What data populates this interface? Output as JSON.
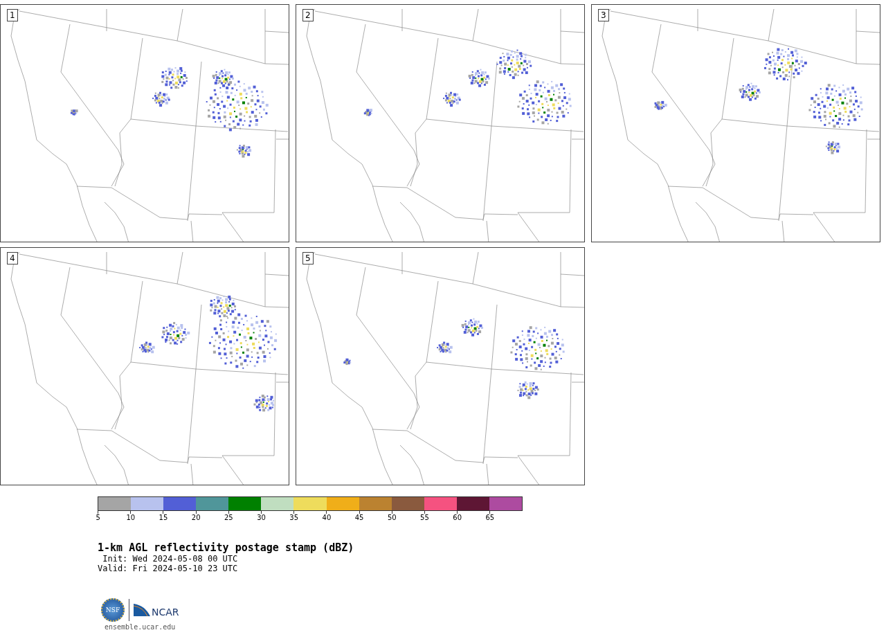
{
  "panels": [
    {
      "label": "1"
    },
    {
      "label": "2"
    },
    {
      "label": "3"
    },
    {
      "label": "4"
    },
    {
      "label": "5"
    }
  ],
  "colorbar": {
    "segments": [
      {
        "color": "#a5a5a5"
      },
      {
        "color": "#b8c2ee"
      },
      {
        "color": "#525fd6"
      },
      {
        "color": "#50969a"
      },
      {
        "color": "#008000"
      },
      {
        "color": "#c0dec0"
      },
      {
        "color": "#eedc5c"
      },
      {
        "color": "#f0ae19"
      },
      {
        "color": "#bb8230"
      },
      {
        "color": "#8a5a3e"
      },
      {
        "color": "#f55280"
      },
      {
        "color": "#5e1634"
      },
      {
        "color": "#ad4ba0"
      }
    ],
    "ticks": [
      "5",
      "10",
      "15",
      "20",
      "25",
      "30",
      "35",
      "40",
      "45",
      "50",
      "55",
      "60",
      "65"
    ]
  },
  "title": "1-km AGL reflectivity postage stamp (dBZ)",
  "init": " Init: Wed 2024-05-08 00 UTC",
  "valid": "Valid: Fri 2024-05-10 23 UTC",
  "logos": {
    "nsf": "NSF",
    "ncar": "NCAR"
  },
  "url": "ensemble.ucar.edu"
}
